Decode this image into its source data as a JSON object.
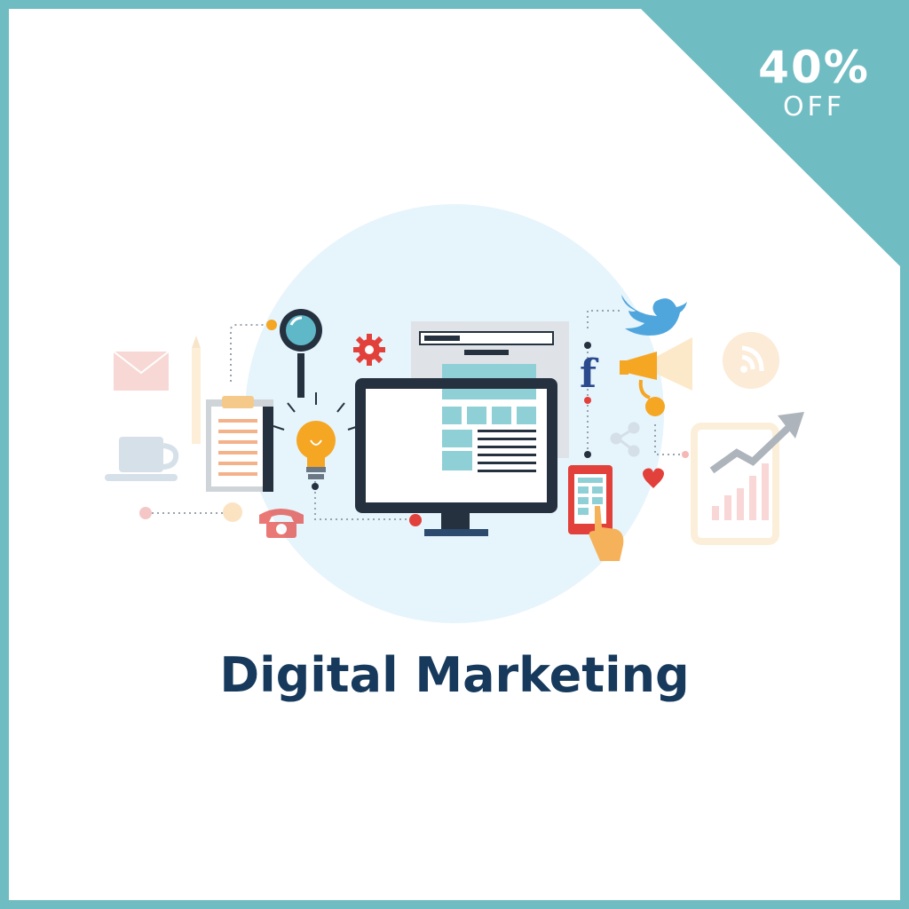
{
  "title": "Digital Marketing",
  "badge": {
    "percent": "40%",
    "off": "OFF"
  },
  "colors": {
    "frame": "#6fbcc2",
    "title": "#16395c",
    "circle": "#e6f4fc",
    "monitor": "#25313f",
    "accent_orange": "#f5a623",
    "accent_red": "#e2403b"
  },
  "icons": {
    "facebook_letter": "f"
  }
}
